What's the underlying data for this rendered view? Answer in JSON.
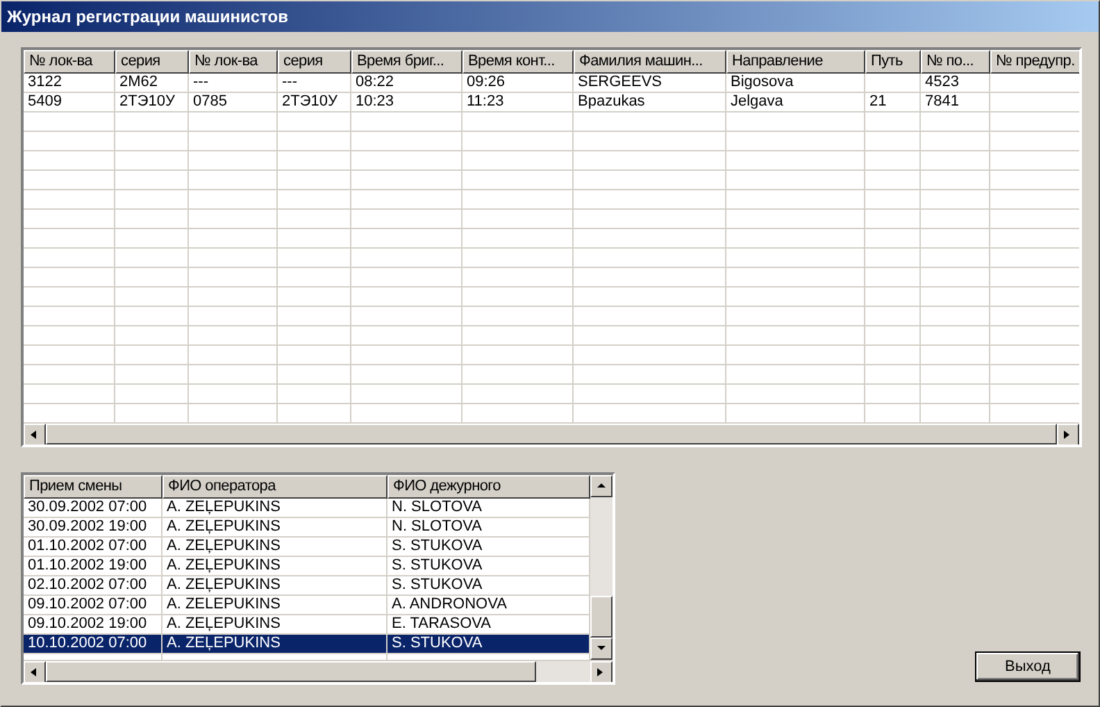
{
  "window": {
    "title": "Журнал регистрации машинистов"
  },
  "main_table": {
    "columns": [
      "№  лок-ва",
      "серия",
      "№  лок-ва",
      "серия",
      "Время бриг...",
      "Время конт...",
      "Фамилия машин...",
      "Направление",
      "Путь",
      "№ по...",
      "№ предупр."
    ],
    "rows": [
      {
        "cells": [
          "3122",
          "2М62",
          "---",
          "---",
          "08:22",
          "09:26",
          "SERGEEVS",
          "Bigosova",
          "",
          "4523",
          ""
        ]
      },
      {
        "cells": [
          "5409",
          "2ТЭ10У",
          "0785",
          "2ТЭ10У",
          "10:23",
          "11:23",
          "Bpazukas",
          "Jelgava",
          "21",
          "7841",
          ""
        ]
      }
    ]
  },
  "shift_table": {
    "columns": [
      "Прием смены",
      "ФИО оператора",
      "ФИО дежурного"
    ],
    "rows": [
      {
        "cells": [
          "30.09.2002 07:00",
          "A. ZEĻEPUKINS",
          "N. SLOTOVA"
        ],
        "selected": false
      },
      {
        "cells": [
          "30.09.2002 19:00",
          "A. ZEĻEPUKINS",
          "N. SLOTOVA"
        ],
        "selected": false
      },
      {
        "cells": [
          "01.10.2002 07:00",
          "A. ZEĻEPUKINS",
          "S. STUKOVA"
        ],
        "selected": false
      },
      {
        "cells": [
          "01.10.2002 19:00",
          "A. ZEĻEPUKINS",
          "S. STUKOVA"
        ],
        "selected": false
      },
      {
        "cells": [
          "02.10.2002 07:00",
          "A. ZEĻEPUKINS",
          "S. STUKOVA"
        ],
        "selected": false
      },
      {
        "cells": [
          "09.10.2002 07:00",
          "A. ZELEPUKINS",
          "A. ANDRONOVA"
        ],
        "selected": false
      },
      {
        "cells": [
          "09.10.2002 19:00",
          "A. ZEĻEPUKINS",
          "E. TARASOVA"
        ],
        "selected": false
      },
      {
        "cells": [
          "10.10.2002 07:00",
          "A. ZEĻEPUKINS",
          "S. STUKOVA"
        ],
        "selected": true
      }
    ]
  },
  "buttons": [
    {
      "label": "Выход"
    }
  ]
}
